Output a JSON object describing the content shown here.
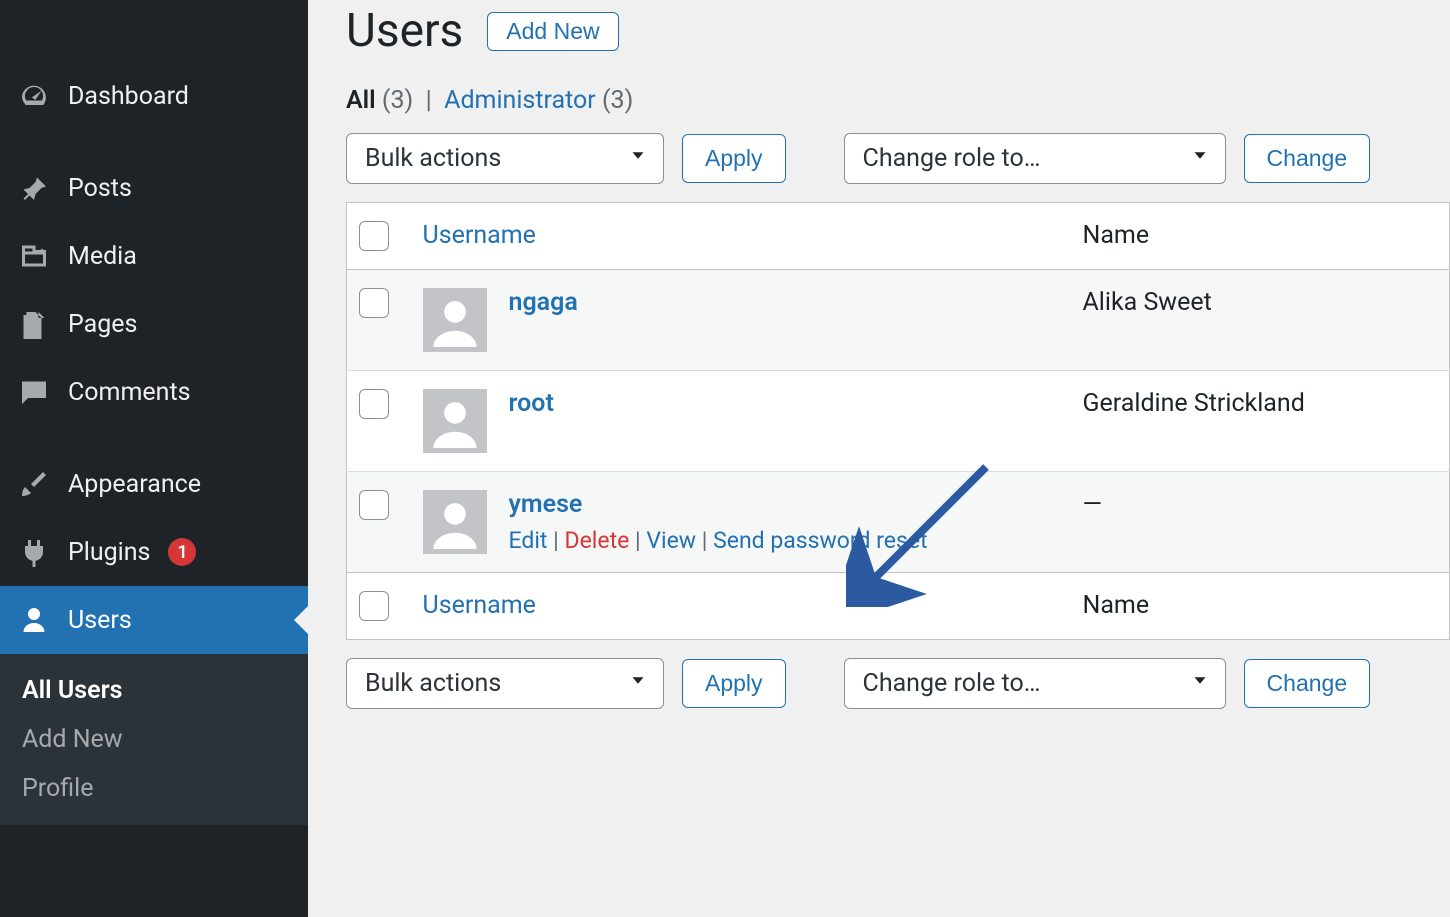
{
  "sidebar": {
    "items": [
      {
        "label": "Dashboard"
      },
      {
        "label": "Posts"
      },
      {
        "label": "Media"
      },
      {
        "label": "Pages"
      },
      {
        "label": "Comments"
      },
      {
        "label": "Appearance"
      },
      {
        "label": "Plugins",
        "badge": "1"
      },
      {
        "label": "Users"
      }
    ],
    "sub": [
      {
        "label": "All Users"
      },
      {
        "label": "Add New"
      },
      {
        "label": "Profile"
      }
    ]
  },
  "page": {
    "title": "Users",
    "add_new": "Add New"
  },
  "filters": {
    "all_label": "All",
    "all_count": "(3)",
    "admin_label": "Administrator",
    "admin_count": "(3)",
    "separator": "|"
  },
  "toolbar": {
    "bulk_label": "Bulk actions",
    "apply_label": "Apply",
    "role_label": "Change role to…",
    "change_label": "Change"
  },
  "table": {
    "col_username": "Username",
    "col_name": "Name",
    "rows": [
      {
        "username": "ngaga",
        "name": "Alika Sweet"
      },
      {
        "username": "root",
        "name": "Geraldine Strickland"
      },
      {
        "username": "ymese",
        "name": "—"
      }
    ],
    "actions": {
      "edit": "Edit",
      "delete": "Delete",
      "view": "View",
      "reset": "Send password reset"
    }
  }
}
